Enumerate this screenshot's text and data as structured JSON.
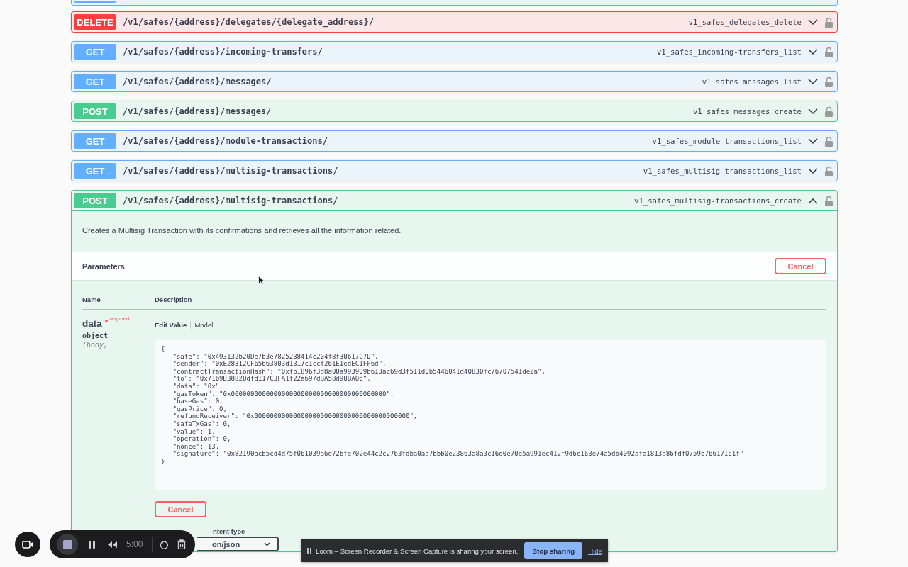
{
  "partial_operation": {
    "kind": "get"
  },
  "operations": [
    {
      "method": "DELETE",
      "kind": "delete",
      "path": "/v1/safes/{address}/delegates/{delegate_address}/",
      "operation_id": "v1_safes_delegates_delete",
      "expanded": false
    },
    {
      "method": "GET",
      "kind": "get",
      "path": "/v1/safes/{address}/incoming-transfers/",
      "operation_id": "v1_safes_incoming-transfers_list",
      "expanded": false
    },
    {
      "method": "GET",
      "kind": "get",
      "path": "/v1/safes/{address}/messages/",
      "operation_id": "v1_safes_messages_list",
      "expanded": false
    },
    {
      "method": "POST",
      "kind": "post",
      "path": "/v1/safes/{address}/messages/",
      "operation_id": "v1_safes_messages_create",
      "expanded": false
    },
    {
      "method": "GET",
      "kind": "get",
      "path": "/v1/safes/{address}/module-transactions/",
      "operation_id": "v1_safes_module-transactions_list",
      "expanded": false
    },
    {
      "method": "GET",
      "kind": "get",
      "path": "/v1/safes/{address}/multisig-transactions/",
      "operation_id": "v1_safes_multisig-transactions_list",
      "expanded": false
    },
    {
      "method": "POST",
      "kind": "post",
      "path": "/v1/safes/{address}/multisig-transactions/",
      "operation_id": "v1_safes_multisig-transactions_create",
      "expanded": true
    }
  ],
  "expanded_operation": {
    "description": "Creates a Multisig Transaction with its confirmations and retrieves all the information related.",
    "parameters_title": "Parameters",
    "cancel_button": "Cancel",
    "columns": [
      "Name",
      "Description"
    ],
    "parameter": {
      "name": "data",
      "required": "required",
      "type": "object",
      "location": "(body)",
      "tabs": [
        {
          "label": "Edit Value",
          "selected": true
        },
        {
          "label": "Model",
          "selected": false
        }
      ],
      "value": "{\n   \"safe\": \"0x493132b20De7b3e7825238414c204f8f30b17C7D\",\n   \"sender\": \"0xE28312CF65663803d1317c1ccf261E1edEC1FF6d\",\n   \"contractTransactionHash\": \"0xfb1896f3d8a00a993909b613ac69d3f511d0b5446041d40830fc76707541de2a\",\n   \"to\": \"0x7169D38820dfd117C3FA1f22a697dBA58d90BA06\",\n   \"data\": \"0x\",\n   \"gasToken\": \"0x0000000000000000000000000000000000000000\",\n   \"baseGas\": 0,\n   \"gasPrice\": 0,\n   \"refundReceiver\": \"0x0000000000000000000000000000000000000000\",\n   \"safeTxGas\": 0,\n   \"value\": 1,\n   \"operation\": 0,\n   \"nonce\": 13,\n   \"signature\": \"0x82190acb5cd4d75f061039a6d72bfe702e44c2c2763fdba0aa7bbb0e23863a8a3c16d0e70e5a991ec412f9d6c163e74a5db4092afa1813a86fdf0759b76617161f\"\n}"
    },
    "cancel_button_2": "Cancel",
    "content_type_label": "ntent type",
    "content_type_value": "on/json"
  },
  "recorder": {
    "timer": "5:00"
  },
  "share_bar": {
    "message": "Loom – Screen Recorder & Screen Capture is sharing your screen.",
    "stop_button": "Stop sharing",
    "hide_link": "Hide"
  }
}
